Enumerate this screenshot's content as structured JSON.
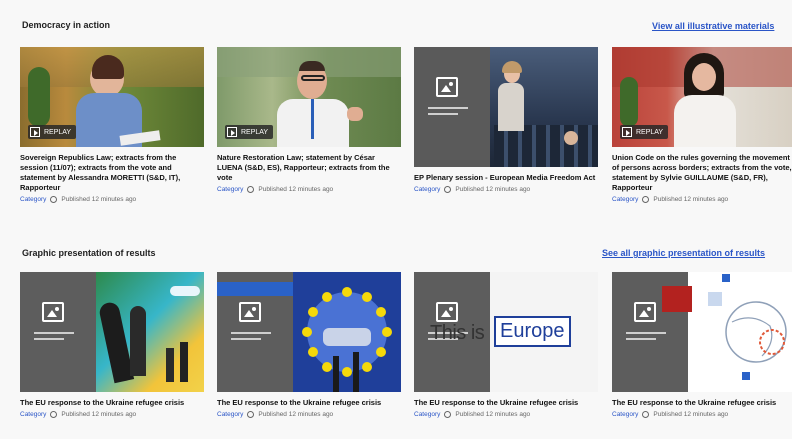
{
  "sections": {
    "democracy": {
      "title": "Democracy in action",
      "see_all": "View all illustrative materials"
    },
    "graphic": {
      "title": "Graphic presentation of results",
      "see_all": "See all graphic presentation of results"
    }
  },
  "video_cards": [
    {
      "badge": "REPLAY",
      "title": "Sovereign Republics Law; extracts from the session (11/07); extracts from the vote and statement by Alessandra MORETTI (S&D, IT), Rapporteur",
      "category": "Category",
      "published": "Published 12 minutes ago"
    },
    {
      "badge": "REPLAY",
      "title": "Nature Restoration Law; statement by César LUENA (S&D, ES), Rapporteur; extracts from the vote",
      "category": "Category",
      "published": "Published 12 minutes ago"
    },
    {
      "badge": "",
      "title": "EP Plenary session - European Media Freedom Act",
      "category": "Category",
      "published": "Published 12 minutes ago"
    },
    {
      "badge": "REPLAY",
      "title": "Union Code on the rules governing the movement of persons across borders; extracts from the vote, statement by Sylvie GUILLAUME (S&D, FR), Rapporteur",
      "category": "Category",
      "published": "Published 12 minutes ago"
    }
  ],
  "graphic_cards": [
    {
      "title": "The EU response to the Ukraine refugee crisis",
      "category": "Category",
      "published": "Published 12 minutes ago"
    },
    {
      "title": "The EU response to the Ukraine refugee crisis",
      "category": "Category",
      "published": "Published 12 minutes ago"
    },
    {
      "title": "The EU response to the Ukraine refugee crisis",
      "overlay_text": "This is",
      "overlay_brand": "Europe",
      "category": "Category",
      "published": "Published 12 minutes ago"
    },
    {
      "title": "The EU response to the Ukraine refugee crisis",
      "category": "Category",
      "published": "Published 12 minutes ago"
    }
  ],
  "colors": {
    "link": "#2a55c7",
    "eu_blue": "#1f3f9a",
    "eu_yellow": "#f5d90a"
  }
}
